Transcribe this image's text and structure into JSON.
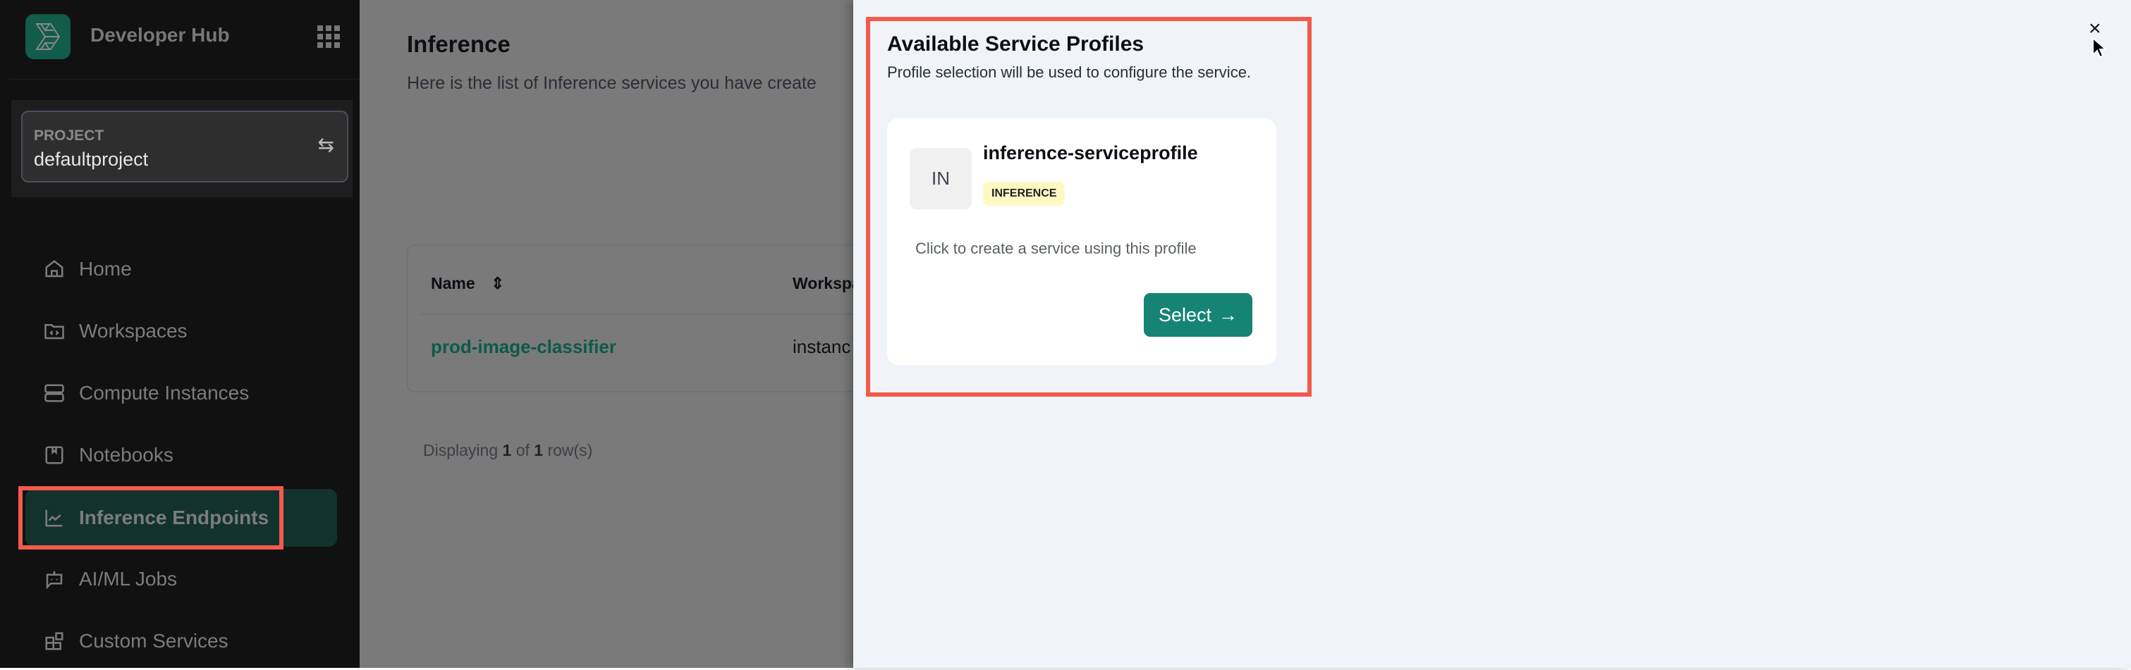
{
  "sidebar": {
    "app_title": "Developer Hub",
    "project": {
      "label": "PROJECT",
      "name": "defaultproject"
    },
    "items": [
      {
        "label": "Home",
        "icon": "home-icon"
      },
      {
        "label": "Workspaces",
        "icon": "folder-code-icon"
      },
      {
        "label": "Compute Instances",
        "icon": "server-icon"
      },
      {
        "label": "Notebooks",
        "icon": "notebook-icon"
      },
      {
        "label": "Inference Endpoints",
        "icon": "chart-line-icon",
        "active": true
      },
      {
        "label": "AI/ML Jobs",
        "icon": "bot-icon"
      },
      {
        "label": "Custom Services",
        "icon": "blocks-icon"
      }
    ]
  },
  "main": {
    "title": "Inference",
    "subtitle": "Here is the list of Inference services you have create",
    "table": {
      "headers": [
        "Name",
        "Workspa"
      ],
      "rows": [
        [
          "prod-image-classifier",
          "instanc"
        ]
      ]
    },
    "footer": {
      "prefix": "Displaying",
      "shown": "1",
      "of": "of",
      "total": "1",
      "suffix": "row(s)"
    }
  },
  "drawer": {
    "title": "Available Service Profiles",
    "subtitle": "Profile selection will be used to configure the service.",
    "profiles": [
      {
        "initials": "IN",
        "name": "inference-serviceprofile",
        "badge": "INFERENCE",
        "description": "Click to create a service using this profile",
        "button": "Select"
      }
    ],
    "close": "×"
  },
  "colors": {
    "accent": "#168474",
    "highlight": "#f25a4b",
    "badge_bg": "#fef9c3",
    "active_nav": "#12332d"
  }
}
